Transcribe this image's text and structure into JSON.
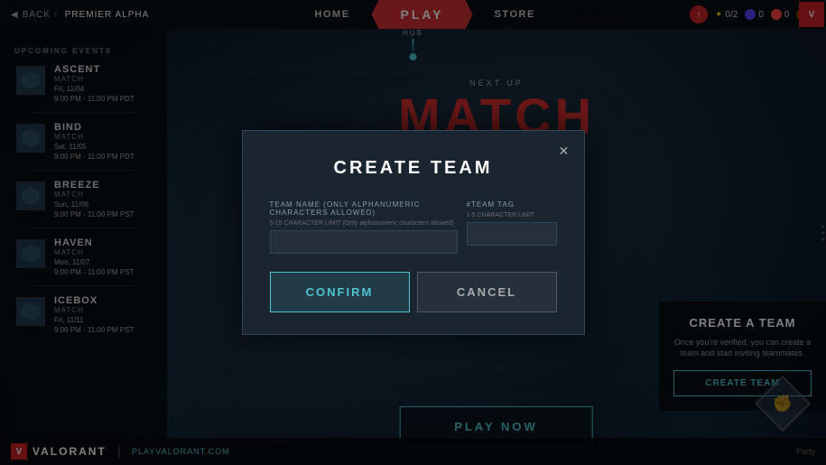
{
  "app": {
    "title": "VALORANT",
    "section": "PREMIER ALPHA",
    "logo_text": "V",
    "website": "PLAYVALORANT.COM"
  },
  "nav": {
    "back_label": "BACK",
    "section_label": "PREMIER ALPHA",
    "home_label": "HOME",
    "play_label": "PLAY",
    "store_label": "STORE",
    "hub_label": "HUB",
    "currency_vp": "0",
    "currency_rp": "0",
    "currency_kp": "0",
    "agent_slots": "0/2"
  },
  "sidebar": {
    "section_title": "UPCOMING EVENTS",
    "events": [
      {
        "name": "ASCENT",
        "type": "MATCH",
        "day": "Fri, 11/04",
        "time": "9:00 PM - 11:00 PM PDT"
      },
      {
        "name": "BIND",
        "type": "MATCH",
        "day": "Sat, 11/05",
        "time": "9:00 PM - 11:00 PM PDT"
      },
      {
        "name": "BREEZE",
        "type": "MATCH",
        "day": "Sun, 11/06",
        "time": "9:00 PM - 11:00 PM PST"
      },
      {
        "name": "HAVEN",
        "type": "MATCH",
        "day": "Mon, 11/07",
        "time": "9:00 PM - 11:00 PM PST"
      },
      {
        "name": "ICEBOX",
        "type": "MATCH",
        "day": "Fri, 11/11",
        "time": "9:00 PM - 11:00 PM PST"
      }
    ]
  },
  "main": {
    "next_up_label": "NEXT UP",
    "match_title": "MATCH"
  },
  "right_panel": {
    "create_team_title": "CREATE A TEAM",
    "create_team_desc": "Once you're verified, you can create a team and start inviting teammates.",
    "create_team_btn": "CREATE TEAM"
  },
  "play_now_btn": "PLAY NOW",
  "modal": {
    "title": "CREATE TEAM",
    "team_name_label": "TEAM NAME (Only alphanumeric characters allowed)",
    "team_name_sublabel": "5-15 CHARACTER LIMIT (Only alphanumeric characters allowed)",
    "team_name_placeholder": "",
    "team_tag_label": "#TEAM TAG",
    "team_tag_sublabel": "1-5 CHARACTER LIMIT",
    "team_tag_placeholder": "",
    "confirm_label": "CONFIRM",
    "cancel_label": "CANCEL",
    "close_icon": "✕"
  },
  "bottom": {
    "party_label": "Party"
  }
}
